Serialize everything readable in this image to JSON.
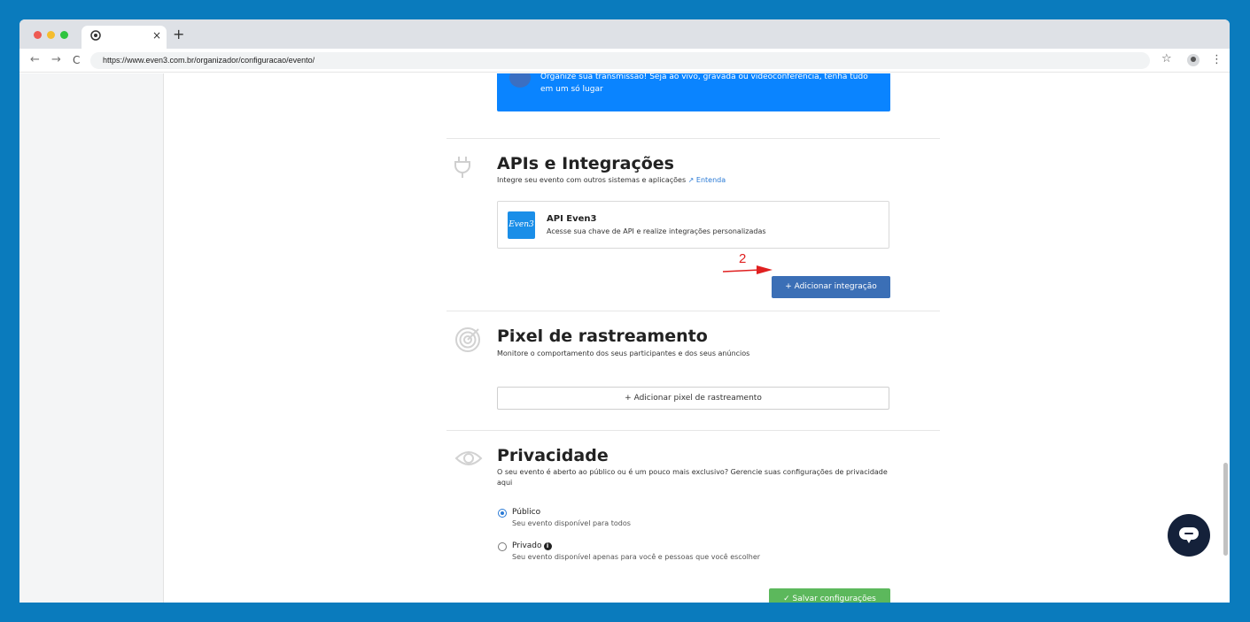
{
  "browser": {
    "tab_icon": "chrome-icon",
    "tab_close": "×",
    "new_tab": "+",
    "back": "←",
    "forward": "→",
    "reload": "C",
    "url": "https://www.even3.com.br/organizador/configuracao/evento/",
    "star": "☆",
    "menu": "⋮"
  },
  "banner": {
    "text": "Organize sua transmissão! Seja ao vivo, gravada ou videoconferência, tenha tudo em um só lugar"
  },
  "apis": {
    "icon": "plug-icon",
    "title": "APIs e Integrações",
    "description": "Integre seu evento com outros sistemas e aplicações",
    "link": "Entenda",
    "card": {
      "logo_text": "Even3",
      "name": "API Even3",
      "description": "Acesse sua chave de API e realize integrações personalizadas"
    },
    "add_button": "+ Adicionar integração"
  },
  "annotation": {
    "number": "2",
    "color": "#e02020"
  },
  "pixel": {
    "icon": "target-icon",
    "title": "Pixel de rastreamento",
    "description": "Monitore o comportamento dos seus participantes e dos seus anúncios",
    "add_button": "+ Adicionar pixel de rastreamento"
  },
  "privacy": {
    "icon": "eye-icon",
    "title": "Privacidade",
    "description": "O seu evento é aberto ao público ou é um pouco mais exclusivo? Gerencie suas configurações de privacidade aqui",
    "options": [
      {
        "label": "Público",
        "description": "Seu evento disponível para todos",
        "selected": true
      },
      {
        "label": "Privado",
        "description": "Seu evento disponível apenas para você e pessoas que você escolher",
        "selected": false
      }
    ],
    "save_button": "✓ Salvar configurações"
  },
  "colors": {
    "background": "#0a7bbd",
    "primary_button": "#3b6fb6",
    "save_button": "#5cb85c",
    "banner": "#0a84ff",
    "chat_button": "#14213a"
  }
}
